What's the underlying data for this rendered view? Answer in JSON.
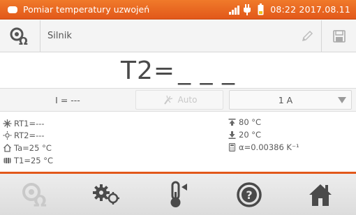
{
  "status_bar": {
    "title": "Pomiar temperatury uzwojeń",
    "time": "08:22",
    "date": "2017.08.11",
    "accent_color": "#e8641e",
    "icons": [
      "app-icon",
      "signal-icon",
      "plug-icon",
      "battery-icon"
    ]
  },
  "header": {
    "object_name": "Silnik",
    "icons": [
      "probe-icon",
      "pencil-icon",
      "save-icon"
    ]
  },
  "reading": {
    "label": "T2=",
    "value": "_ _ _"
  },
  "controls": {
    "current_readout": "I = ---",
    "auto_label": "Auto",
    "range_value": "1 A"
  },
  "info": {
    "rt1": "RT1=---",
    "rt2": "RT2=---",
    "ta": "Ta=25 °C",
    "t1": "T1=25 °C",
    "temp_high": "80 °C",
    "temp_low": "20 °C",
    "alpha": "α=0.00386 K⁻¹"
  },
  "toolbar": {
    "items": [
      "probe-button",
      "settings-button",
      "temperature-button",
      "help-button",
      "home-button"
    ]
  }
}
